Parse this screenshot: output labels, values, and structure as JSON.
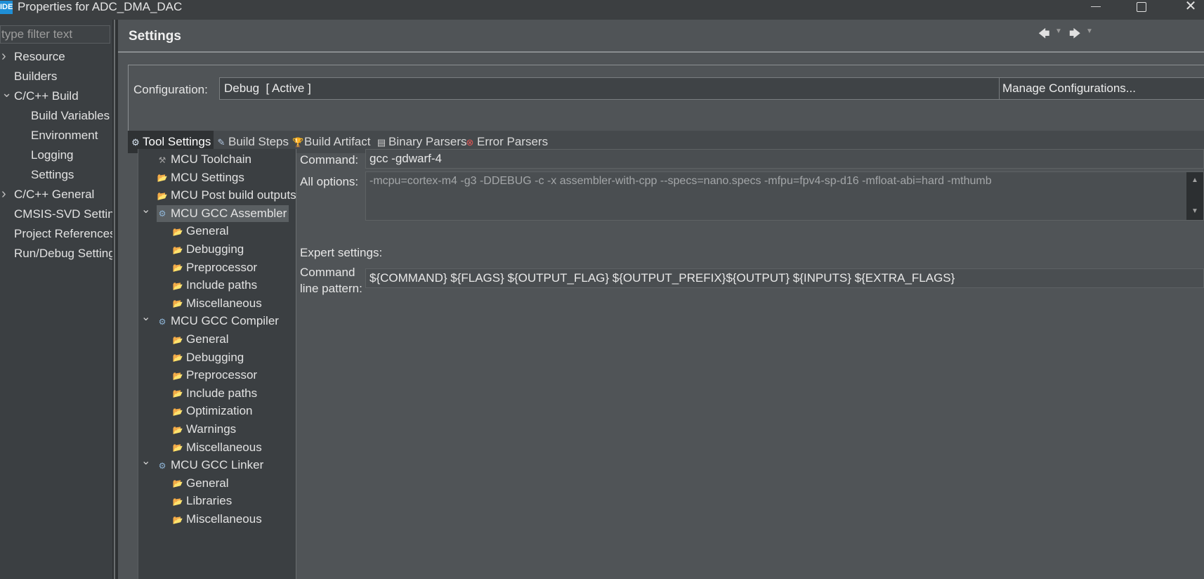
{
  "window": {
    "title": "Properties for ADC_DMA_DAC",
    "app_icon_text": "IDE"
  },
  "left_nav": {
    "filter_placeholder": "type filter text",
    "items": [
      {
        "label": "Resource",
        "expand": "collapsed"
      },
      {
        "label": "Builders"
      },
      {
        "label": "C/C++ Build",
        "expand": "expanded"
      },
      {
        "label": "Build Variables"
      },
      {
        "label": "Environment"
      },
      {
        "label": "Logging"
      },
      {
        "label": "Settings",
        "selected": true
      },
      {
        "label": "C/C++ General",
        "expand": "collapsed"
      },
      {
        "label": "CMSIS-SVD Settings"
      },
      {
        "label": "Project References"
      },
      {
        "label": "Run/Debug Settings"
      }
    ]
  },
  "main": {
    "title": "Settings",
    "configuration": {
      "label": "Configuration:",
      "value": "Debug  [ Active ]",
      "manage_label": "Manage Configurations..."
    },
    "tabs": [
      {
        "label": "Tool Settings",
        "icon": "tool-settings-icon",
        "active": true
      },
      {
        "label": "Build Steps",
        "icon": "build-steps-icon"
      },
      {
        "label": "Build Artifact",
        "icon": "trophy-icon"
      },
      {
        "label": "Binary Parsers",
        "icon": "binary-icon"
      },
      {
        "label": "Error Parsers",
        "icon": "error-icon"
      }
    ],
    "tree": [
      {
        "label": "MCU Toolchain",
        "icon": "tool"
      },
      {
        "label": "MCU Settings",
        "icon": "folder"
      },
      {
        "label": "MCU Post build outputs",
        "icon": "folder"
      },
      {
        "label": "MCU GCC Assembler",
        "icon": "gear",
        "expand": "expanded",
        "selected": true
      },
      {
        "label": "General",
        "icon": "folder"
      },
      {
        "label": "Debugging",
        "icon": "folder"
      },
      {
        "label": "Preprocessor",
        "icon": "folder"
      },
      {
        "label": "Include paths",
        "icon": "folder"
      },
      {
        "label": "Miscellaneous",
        "icon": "folder"
      },
      {
        "label": "MCU GCC Compiler",
        "icon": "gear",
        "expand": "expanded"
      },
      {
        "label": "General",
        "icon": "folder"
      },
      {
        "label": "Debugging",
        "icon": "folder"
      },
      {
        "label": "Preprocessor",
        "icon": "folder"
      },
      {
        "label": "Include paths",
        "icon": "folder"
      },
      {
        "label": "Optimization",
        "icon": "folder"
      },
      {
        "label": "Warnings",
        "icon": "folder"
      },
      {
        "label": "Miscellaneous",
        "icon": "folder"
      },
      {
        "label": "MCU GCC Linker",
        "icon": "gear",
        "expand": "expanded"
      },
      {
        "label": "General",
        "icon": "folder"
      },
      {
        "label": "Libraries",
        "icon": "folder"
      },
      {
        "label": "Miscellaneous",
        "icon": "folder"
      }
    ],
    "options": {
      "command_label": "Command:",
      "command_value": "gcc -gdwarf-4",
      "all_options_label": "All options:",
      "all_options_value": "-mcpu=cortex-m4 -g3 -DDEBUG -c -x assembler-with-cpp --specs=nano.specs -mfpu=fpv4-sp-d16 -mfloat-abi=hard -mthumb",
      "expert_label": "Expert settings:",
      "pattern_label_1": "Command",
      "pattern_label_2": "line pattern:",
      "pattern_value": "${COMMAND} ${FLAGS} ${OUTPUT_FLAG} ${OUTPUT_PREFIX}${OUTPUT} ${INPUTS} ${EXTRA_FLAGS}"
    }
  }
}
